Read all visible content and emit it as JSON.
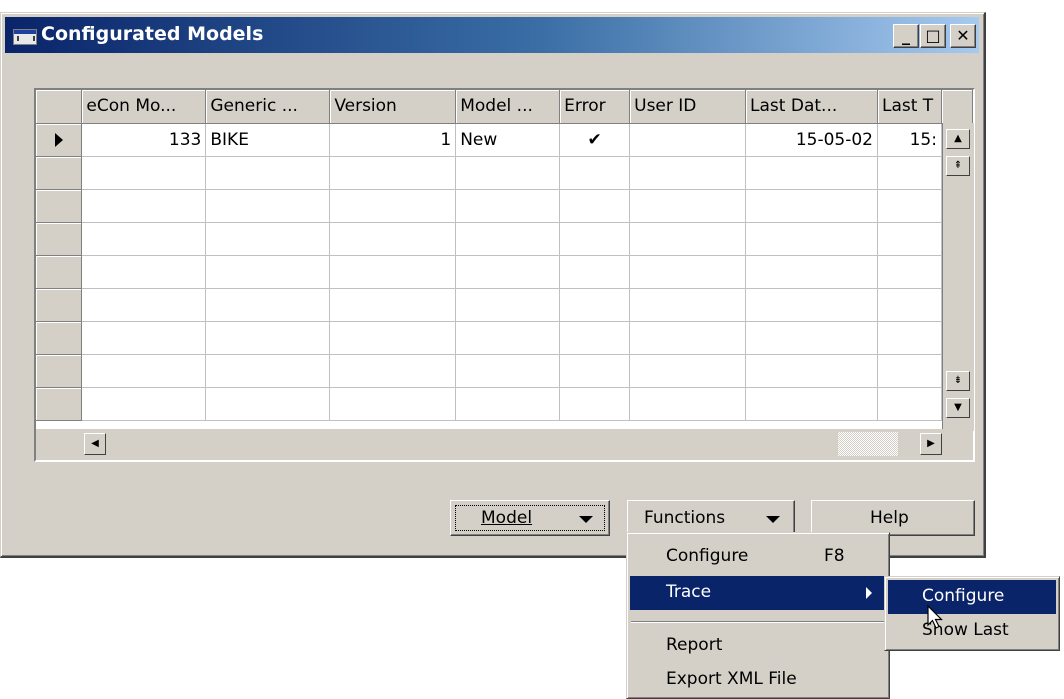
{
  "window": {
    "title": "Configurated Models",
    "minimize_glyph": "_",
    "maximize_glyph": "□",
    "close_glyph": "✕"
  },
  "grid": {
    "columns": [
      "eCon Mo...",
      "Generic ...",
      "Version",
      "Model ...",
      "Error",
      "User ID",
      "Last Dat...",
      "Last T"
    ],
    "row": {
      "econ_model": "133",
      "generic": "BIKE",
      "version": "1",
      "model_status": "New",
      "error_mark": "✔",
      "user_id": "",
      "last_date": "15-05-02",
      "last_time": "15:"
    }
  },
  "buttons": {
    "model": "Model",
    "functions": "Functions",
    "help": "Help"
  },
  "functions_menu": {
    "items": [
      {
        "label": "Configure",
        "shortcut": "F8"
      },
      {
        "label": "Trace"
      },
      {
        "label": "Report"
      },
      {
        "label": "Export XML File"
      }
    ]
  },
  "trace_submenu": {
    "items": [
      {
        "label": "Configure"
      },
      {
        "label": "Show Last"
      }
    ]
  },
  "icons": [
    "app-icon",
    "minimize-icon",
    "maximize-icon",
    "close-icon",
    "row-pointer-icon",
    "scroll-up-icon",
    "scroll-down-icon",
    "scroll-left-icon",
    "scroll-right-icon",
    "dropdown-arrow-icon",
    "submenu-arrow-icon",
    "mouse-cursor-icon"
  ],
  "colors": {
    "title_start": "#0a246a",
    "title_end": "#a6caf0",
    "face": "#d4d0c8",
    "highlight": "#0a246a"
  }
}
